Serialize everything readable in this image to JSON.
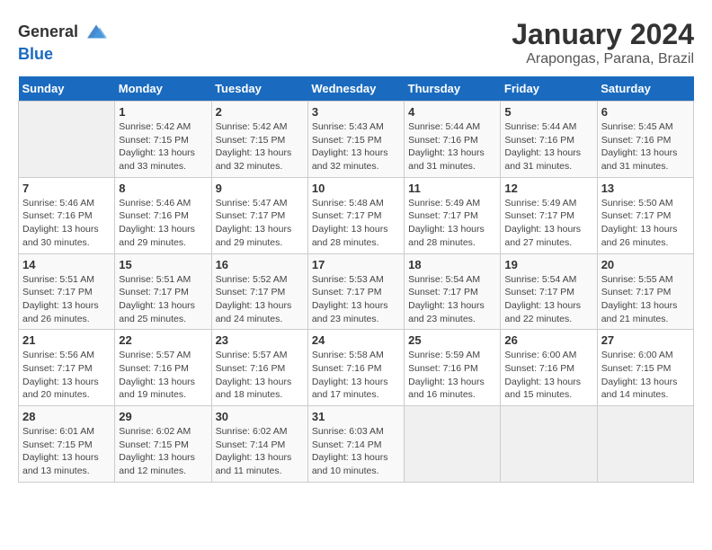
{
  "header": {
    "logo_general": "General",
    "logo_blue": "Blue",
    "title": "January 2024",
    "subtitle": "Arapongas, Parana, Brazil"
  },
  "columns": [
    "Sunday",
    "Monday",
    "Tuesday",
    "Wednesday",
    "Thursday",
    "Friday",
    "Saturday"
  ],
  "weeks": [
    [
      {
        "day": "",
        "info": ""
      },
      {
        "day": "1",
        "info": "Sunrise: 5:42 AM\nSunset: 7:15 PM\nDaylight: 13 hours\nand 33 minutes."
      },
      {
        "day": "2",
        "info": "Sunrise: 5:42 AM\nSunset: 7:15 PM\nDaylight: 13 hours\nand 32 minutes."
      },
      {
        "day": "3",
        "info": "Sunrise: 5:43 AM\nSunset: 7:15 PM\nDaylight: 13 hours\nand 32 minutes."
      },
      {
        "day": "4",
        "info": "Sunrise: 5:44 AM\nSunset: 7:16 PM\nDaylight: 13 hours\nand 31 minutes."
      },
      {
        "day": "5",
        "info": "Sunrise: 5:44 AM\nSunset: 7:16 PM\nDaylight: 13 hours\nand 31 minutes."
      },
      {
        "day": "6",
        "info": "Sunrise: 5:45 AM\nSunset: 7:16 PM\nDaylight: 13 hours\nand 31 minutes."
      }
    ],
    [
      {
        "day": "7",
        "info": "Sunrise: 5:46 AM\nSunset: 7:16 PM\nDaylight: 13 hours\nand 30 minutes."
      },
      {
        "day": "8",
        "info": "Sunrise: 5:46 AM\nSunset: 7:16 PM\nDaylight: 13 hours\nand 29 minutes."
      },
      {
        "day": "9",
        "info": "Sunrise: 5:47 AM\nSunset: 7:17 PM\nDaylight: 13 hours\nand 29 minutes."
      },
      {
        "day": "10",
        "info": "Sunrise: 5:48 AM\nSunset: 7:17 PM\nDaylight: 13 hours\nand 28 minutes."
      },
      {
        "day": "11",
        "info": "Sunrise: 5:49 AM\nSunset: 7:17 PM\nDaylight: 13 hours\nand 28 minutes."
      },
      {
        "day": "12",
        "info": "Sunrise: 5:49 AM\nSunset: 7:17 PM\nDaylight: 13 hours\nand 27 minutes."
      },
      {
        "day": "13",
        "info": "Sunrise: 5:50 AM\nSunset: 7:17 PM\nDaylight: 13 hours\nand 26 minutes."
      }
    ],
    [
      {
        "day": "14",
        "info": "Sunrise: 5:51 AM\nSunset: 7:17 PM\nDaylight: 13 hours\nand 26 minutes."
      },
      {
        "day": "15",
        "info": "Sunrise: 5:51 AM\nSunset: 7:17 PM\nDaylight: 13 hours\nand 25 minutes."
      },
      {
        "day": "16",
        "info": "Sunrise: 5:52 AM\nSunset: 7:17 PM\nDaylight: 13 hours\nand 24 minutes."
      },
      {
        "day": "17",
        "info": "Sunrise: 5:53 AM\nSunset: 7:17 PM\nDaylight: 13 hours\nand 23 minutes."
      },
      {
        "day": "18",
        "info": "Sunrise: 5:54 AM\nSunset: 7:17 PM\nDaylight: 13 hours\nand 23 minutes."
      },
      {
        "day": "19",
        "info": "Sunrise: 5:54 AM\nSunset: 7:17 PM\nDaylight: 13 hours\nand 22 minutes."
      },
      {
        "day": "20",
        "info": "Sunrise: 5:55 AM\nSunset: 7:17 PM\nDaylight: 13 hours\nand 21 minutes."
      }
    ],
    [
      {
        "day": "21",
        "info": "Sunrise: 5:56 AM\nSunset: 7:17 PM\nDaylight: 13 hours\nand 20 minutes."
      },
      {
        "day": "22",
        "info": "Sunrise: 5:57 AM\nSunset: 7:16 PM\nDaylight: 13 hours\nand 19 minutes."
      },
      {
        "day": "23",
        "info": "Sunrise: 5:57 AM\nSunset: 7:16 PM\nDaylight: 13 hours\nand 18 minutes."
      },
      {
        "day": "24",
        "info": "Sunrise: 5:58 AM\nSunset: 7:16 PM\nDaylight: 13 hours\nand 17 minutes."
      },
      {
        "day": "25",
        "info": "Sunrise: 5:59 AM\nSunset: 7:16 PM\nDaylight: 13 hours\nand 16 minutes."
      },
      {
        "day": "26",
        "info": "Sunrise: 6:00 AM\nSunset: 7:16 PM\nDaylight: 13 hours\nand 15 minutes."
      },
      {
        "day": "27",
        "info": "Sunrise: 6:00 AM\nSunset: 7:15 PM\nDaylight: 13 hours\nand 14 minutes."
      }
    ],
    [
      {
        "day": "28",
        "info": "Sunrise: 6:01 AM\nSunset: 7:15 PM\nDaylight: 13 hours\nand 13 minutes."
      },
      {
        "day": "29",
        "info": "Sunrise: 6:02 AM\nSunset: 7:15 PM\nDaylight: 13 hours\nand 12 minutes."
      },
      {
        "day": "30",
        "info": "Sunrise: 6:02 AM\nSunset: 7:14 PM\nDaylight: 13 hours\nand 11 minutes."
      },
      {
        "day": "31",
        "info": "Sunrise: 6:03 AM\nSunset: 7:14 PM\nDaylight: 13 hours\nand 10 minutes."
      },
      {
        "day": "",
        "info": ""
      },
      {
        "day": "",
        "info": ""
      },
      {
        "day": "",
        "info": ""
      }
    ]
  ]
}
